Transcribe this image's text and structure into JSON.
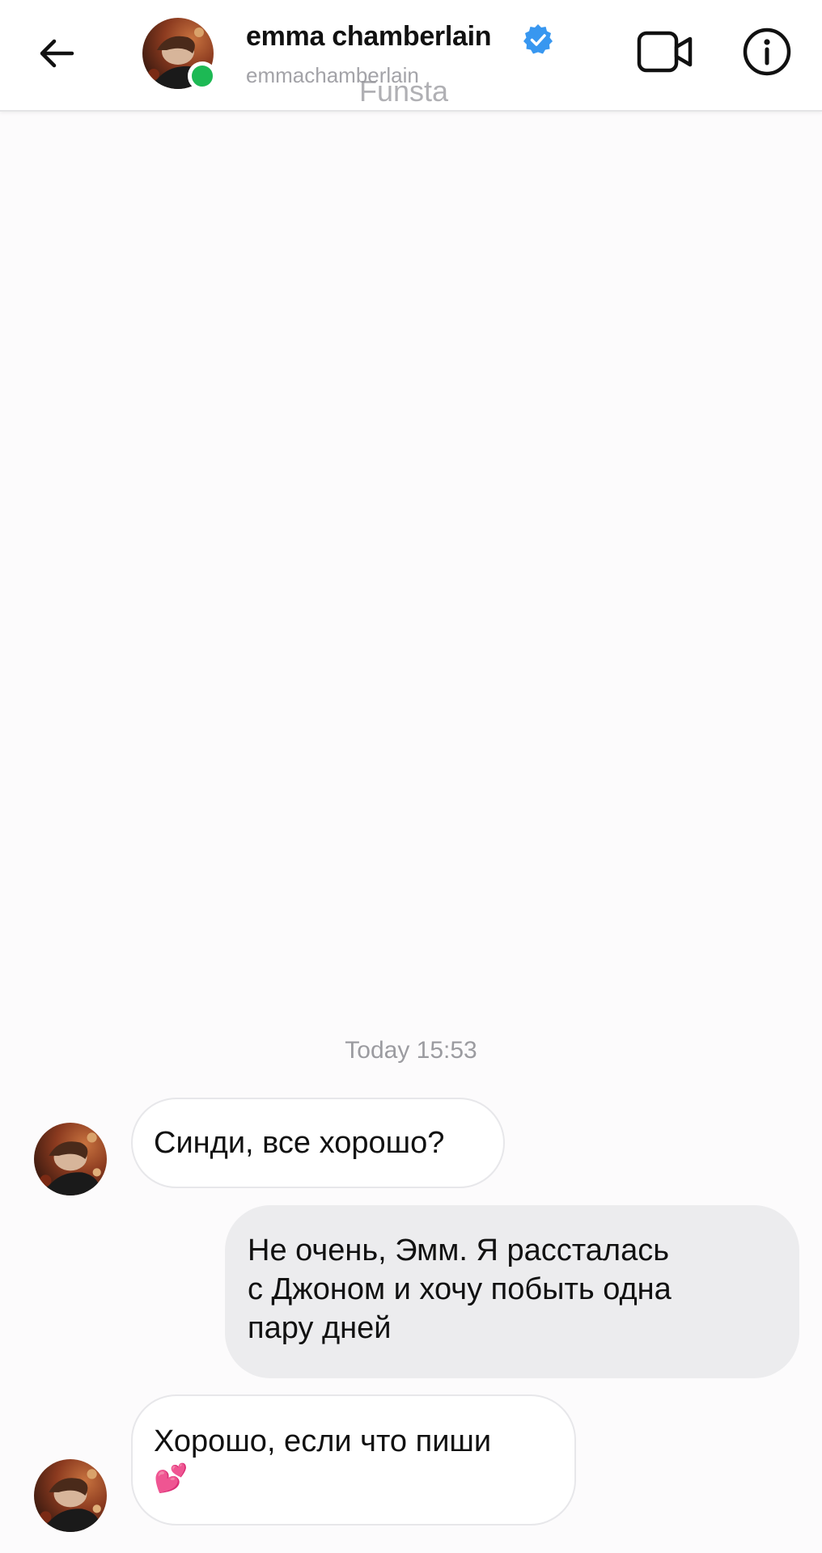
{
  "header": {
    "name": "emma chamberlain",
    "username": "emmachamberlain",
    "overlay_text": "Funsta",
    "online": true,
    "icons": {
      "back": "arrow-left-icon",
      "verified": "verified-badge-icon",
      "video": "video-camera-icon",
      "info": "info-icon"
    }
  },
  "conversation": {
    "timestamp": "Today 15:53",
    "messages": [
      {
        "direction": "incoming",
        "text": "Синди, все хорошо?"
      },
      {
        "direction": "outgoing",
        "lines": [
          "Не очень, Эмм. Я рассталась",
          "с Джоном и хочу побыть одна",
          "пару дней"
        ]
      },
      {
        "direction": "incoming",
        "lines": [
          "Хорошо, если что пиши",
          "💕"
        ]
      }
    ]
  },
  "colors": {
    "background": "#fcfbfc",
    "verified": "#3897f0",
    "online": "#1db954",
    "outgoing_bubble": "#ececee",
    "incoming_border": "#e7e7ea",
    "secondary_text": "#9b9ba0"
  }
}
